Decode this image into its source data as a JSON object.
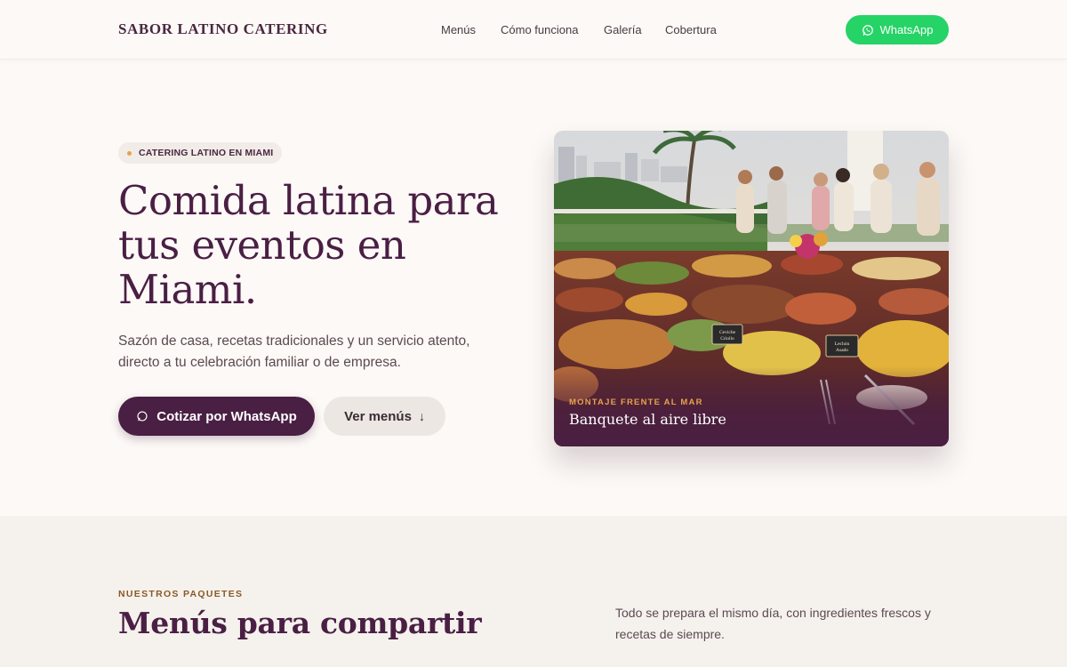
{
  "header": {
    "brand": "SABOR LATINO CATERING",
    "nav": [
      "Menús",
      "Cómo funciona",
      "Galería",
      "Cobertura"
    ],
    "whatsapp_label": "WhatsApp"
  },
  "hero": {
    "badge": "CATERING LATINO EN MIAMI",
    "title": "Comida latina para tus eventos en Miami.",
    "subtitle": "Sazón de casa, recetas tradicionales y un servicio atento, directo a tu celebración familiar o de empresa.",
    "primary_cta": "Cotizar por WhatsApp",
    "secondary_cta": "Ver menús",
    "secondary_icon": "↓",
    "photo": {
      "kicker": "MONTAJE FRENTE AL MAR",
      "caption": "Banquete al aire libre",
      "signs": [
        "Ceviche Criollo",
        "Lechón Asado"
      ]
    }
  },
  "packages": {
    "kicker": "NUESTROS PAQUETES",
    "title": "Menús para compartir",
    "text": "Todo se prepara el mismo día, con ingredientes frescos y recetas de siempre."
  },
  "colors": {
    "brand_plum": "#4a1f44",
    "whatsapp_green": "#25d366",
    "accent_gold": "#e7a24a",
    "background": "#fcf9f6"
  }
}
